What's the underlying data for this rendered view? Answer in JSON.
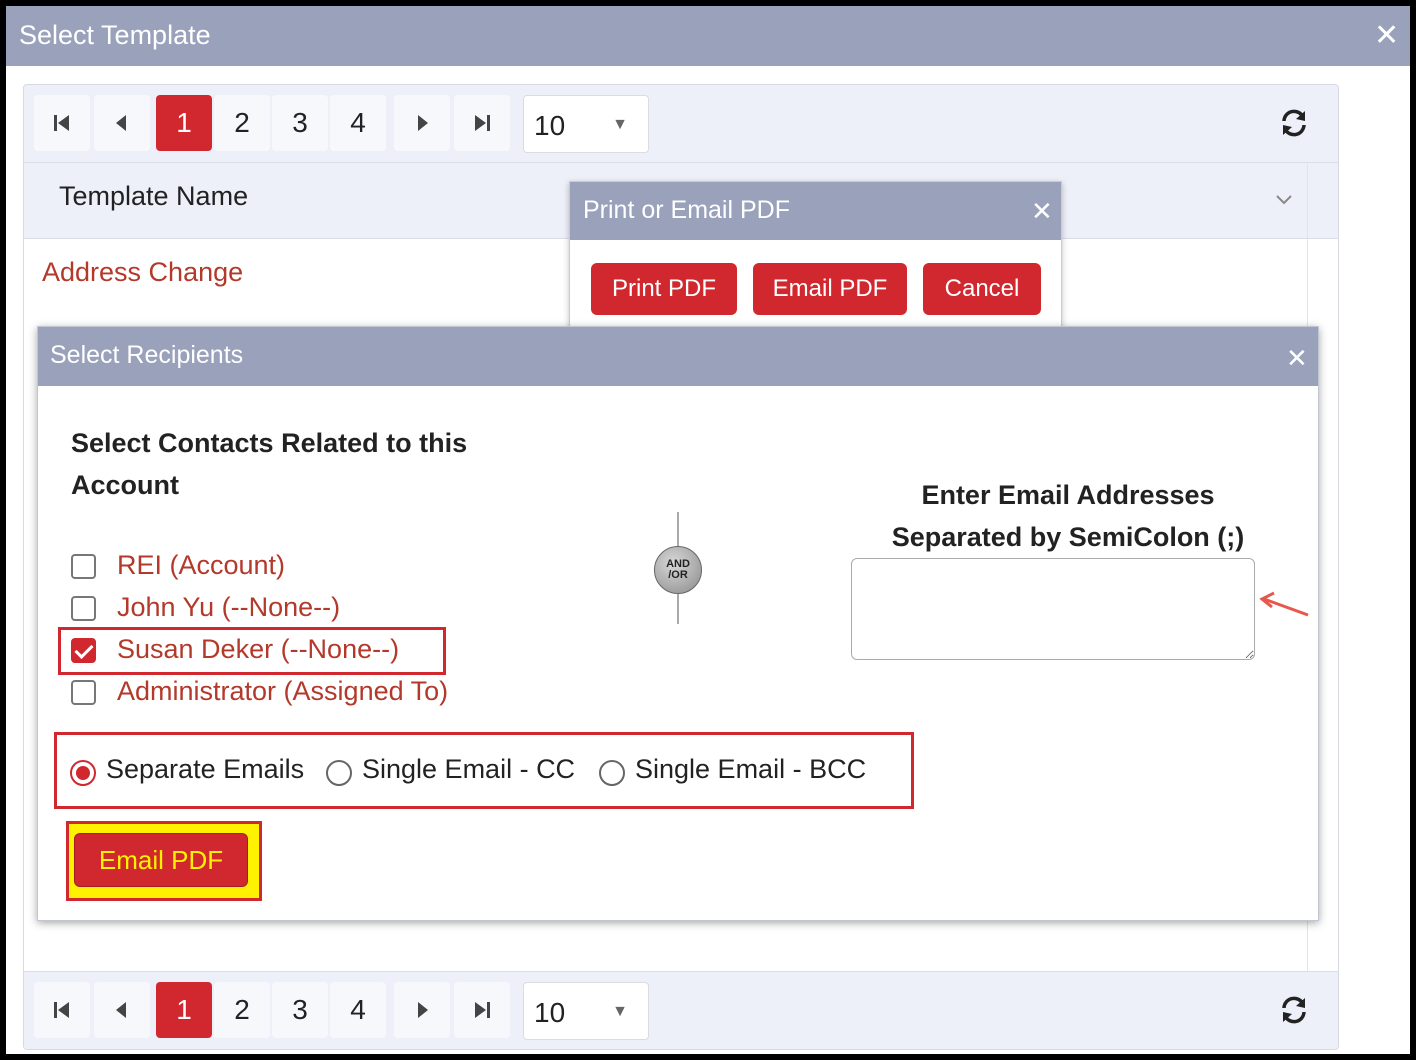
{
  "window": {
    "title": "Select Template"
  },
  "pager": {
    "pages": [
      "1",
      "2",
      "3",
      "4"
    ],
    "active_page": "1",
    "page_size": "10"
  },
  "grid": {
    "column_header": "Template Name",
    "rows": [
      "Address Change"
    ]
  },
  "print_dialog": {
    "title": "Print or Email PDF",
    "print_label": "Print PDF",
    "email_label": "Email PDF",
    "cancel_label": "Cancel"
  },
  "recipients_dialog": {
    "title": "Select Recipients",
    "contacts_heading": "Select Contacts Related to this Account",
    "contacts": [
      {
        "label": "REI (Account)",
        "checked": false
      },
      {
        "label": "John Yu (--None--)",
        "checked": false
      },
      {
        "label": "Susan Deker (--None--)",
        "checked": true
      },
      {
        "label": "Administrator (Assigned To)",
        "checked": false
      }
    ],
    "and_or": "AND/OR",
    "and_text": "AND",
    "or_text": "/OR",
    "email_heading": "Enter Email Addresses Separated by SemiColon (;)",
    "email_value": "",
    "send_options": [
      {
        "label": "Separate Emails",
        "checked": true
      },
      {
        "label": "Single Email - CC",
        "checked": false
      },
      {
        "label": "Single Email - BCC",
        "checked": false
      }
    ],
    "submit_label": "Email PDF"
  },
  "colors": {
    "accent_red": "#d0282e",
    "titlebar": "#99a1bb",
    "link_red": "#b3392b",
    "highlight_yellow": "#fff200"
  }
}
